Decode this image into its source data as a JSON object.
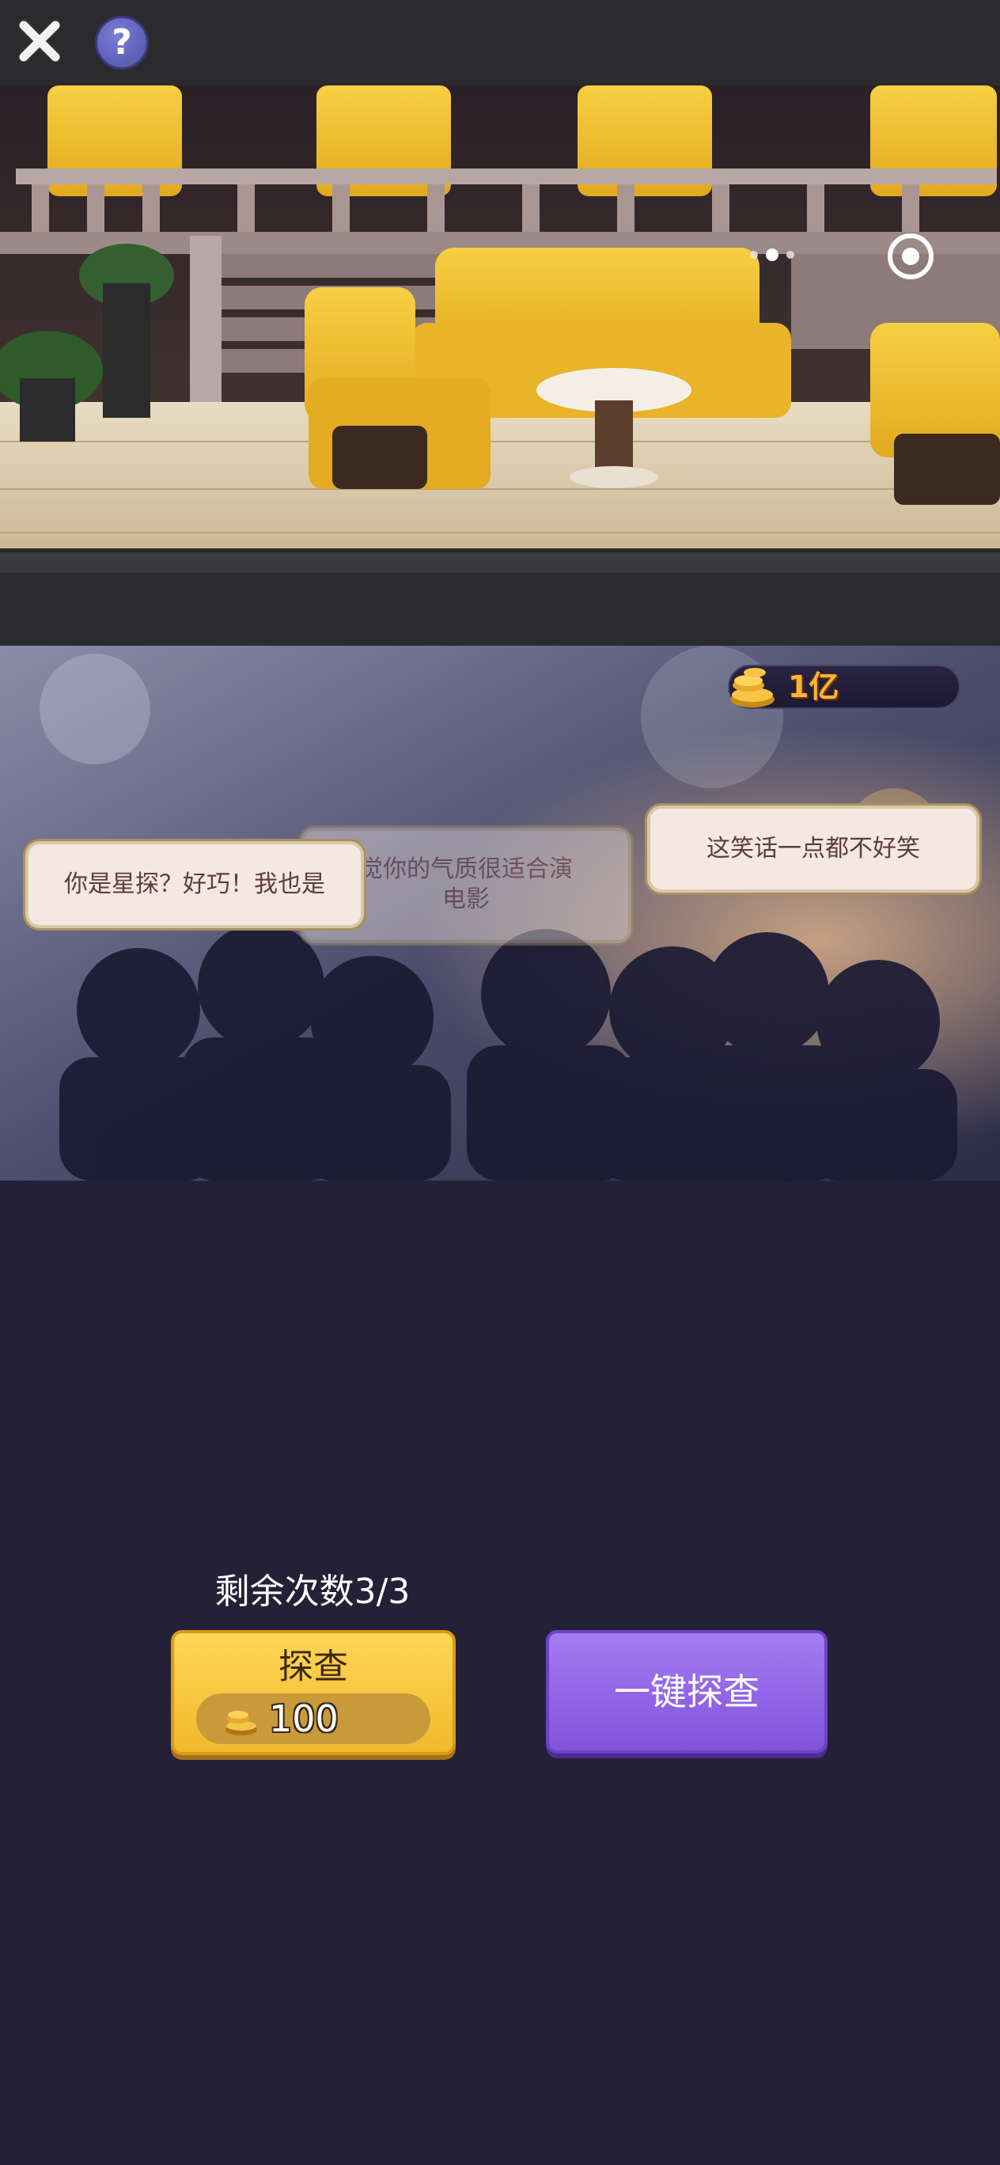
{
  "header": {
    "close_icon": "close-icon",
    "help_label": "?"
  },
  "scene": {
    "carousel": {
      "count": 3,
      "active_index": 1
    },
    "target_icon": "target-icon"
  },
  "currency": {
    "icon": "gold-coin-icon",
    "value": "1亿"
  },
  "bubbles": [
    {
      "text": "你是星探？好巧！我也是"
    },
    {
      "line1": "觉你的气质很适合演",
      "line2": "电影"
    },
    {
      "text": "这笑话一点都不好笑"
    }
  ],
  "controls": {
    "remaining": "剩余次数3/3",
    "probe": {
      "label": "探查",
      "cost": "100",
      "cost_icon": "gold-coin-icon"
    },
    "onekey": {
      "label": "一键探查"
    }
  },
  "colors": {
    "background": "#242036",
    "probe_button": "#ffd656",
    "onekey_button": "#a57cf2",
    "currency_text": "#f7b63a"
  }
}
